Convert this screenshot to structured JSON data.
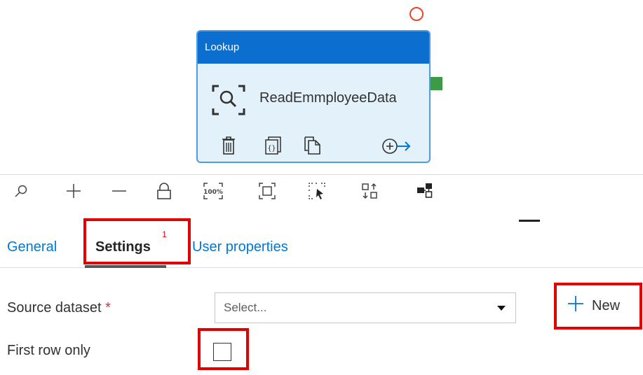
{
  "activity": {
    "type_label": "Lookup",
    "name": "ReadEmmployeeData",
    "icons": [
      "lookup-icon",
      "delete-icon",
      "code-icon",
      "copy-icon",
      "add-output-icon"
    ]
  },
  "toolbar": {
    "icons": [
      "search-icon",
      "zoom-in-icon",
      "zoom-out-icon",
      "lock-icon",
      "zoom-100-icon",
      "fit-to-window-icon",
      "select-icon",
      "auto-align-icon",
      "layout-icon"
    ],
    "zoom_100_text": "100%"
  },
  "tabs": [
    {
      "label": "General"
    },
    {
      "label": "Settings",
      "badge": "1",
      "active": true
    },
    {
      "label": "User properties"
    }
  ],
  "form": {
    "source_dataset": {
      "label": "Source dataset",
      "required_mark": "*",
      "placeholder": "Select...",
      "new_button_label": "New"
    },
    "first_row_only": {
      "label": "First row only",
      "checked": false
    }
  },
  "colors": {
    "node_header": "#0c6fd0",
    "node_body": "#e3f1fb",
    "link_blue": "#0078d4",
    "highlight_red": "#e00000",
    "success_green": "#3d9a47"
  }
}
